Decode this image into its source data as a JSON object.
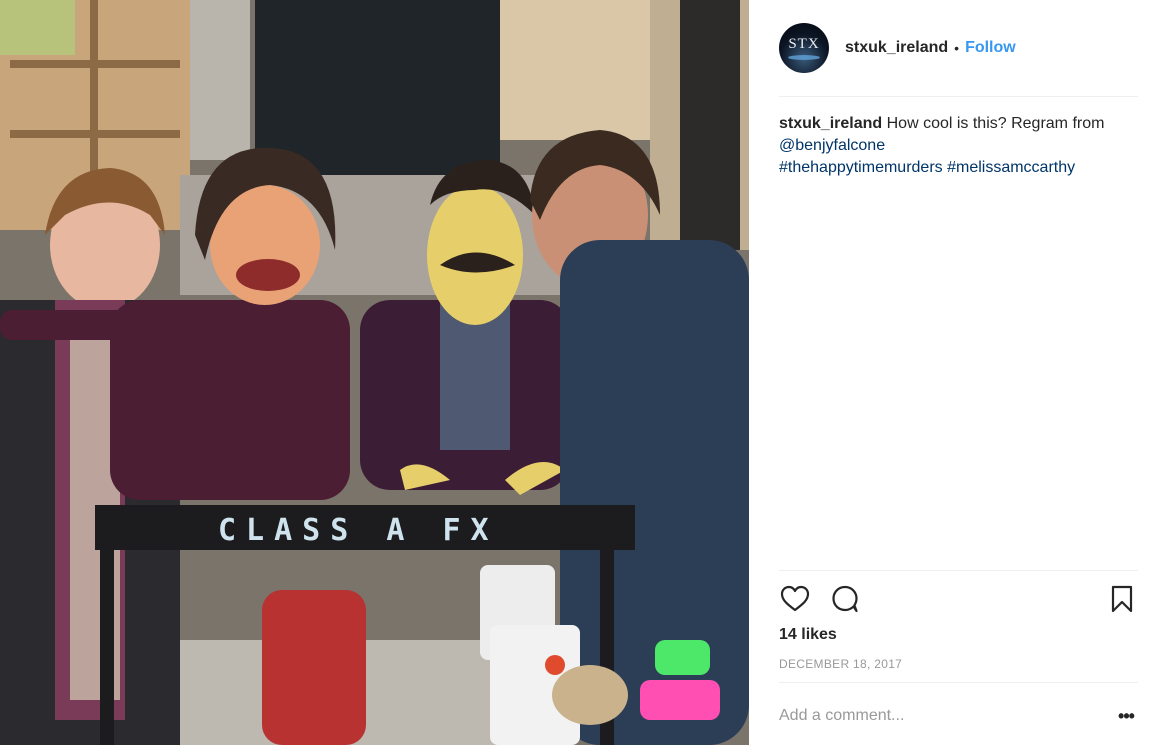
{
  "post": {
    "image_description_icon": "photo",
    "image_sign_text": "CLASS A FX"
  },
  "header": {
    "avatar_icon": "stx-logo-icon",
    "avatar_logo_text": "STX",
    "username": "stxuk_ireland",
    "separator": "•",
    "follow_label": "Follow",
    "follow_color": "#3897f0"
  },
  "caption": {
    "username": "stxuk_ireland",
    "text": "How cool is this? Regram from",
    "mention": "@benjyfalcone",
    "hashtags": [
      "#thehappytimemurders",
      "#melissamccarthy"
    ]
  },
  "actions": {
    "like_icon": "heart-icon",
    "comment_icon": "comment-icon",
    "save_icon": "bookmark-icon"
  },
  "stats": {
    "likes": "14 likes",
    "date": "DECEMBER 18, 2017"
  },
  "comment": {
    "placeholder": "Add a comment...",
    "more_label": "•••"
  }
}
